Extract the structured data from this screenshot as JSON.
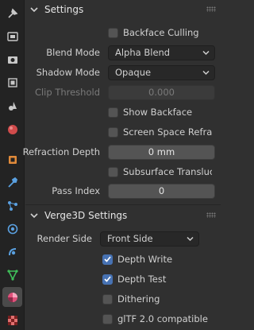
{
  "tabs": [
    {
      "icon": "tool-icon",
      "color": "#c8c8c8"
    },
    {
      "icon": "render-icon",
      "color": "#c8c8c8"
    },
    {
      "icon": "output-icon",
      "color": "#c8c8c8"
    },
    {
      "icon": "view-layer-icon",
      "color": "#c8c8c8"
    },
    {
      "icon": "scene-icon",
      "color": "#c8c8c8"
    },
    {
      "icon": "world-icon",
      "color": "#d04b4b"
    },
    {
      "icon": "object-icon",
      "color": "#e08a3a"
    },
    {
      "icon": "modifier-icon",
      "color": "#5aa0e0"
    },
    {
      "icon": "particles-icon",
      "color": "#5aa0e0"
    },
    {
      "icon": "physics-icon",
      "color": "#5aa0e0"
    },
    {
      "icon": "constraints-icon",
      "color": "#5aa0e0"
    },
    {
      "icon": "object-data-icon",
      "color": "#3fbf5a"
    },
    {
      "icon": "material-icon",
      "color": "#e0507a"
    },
    {
      "icon": "texture-icon",
      "color": "#d04b4b"
    }
  ],
  "settings": {
    "title": "Settings",
    "backface_culling": {
      "label": "Backface Culling",
      "checked": false
    },
    "blend_mode": {
      "label": "Blend Mode",
      "value": "Alpha Blend"
    },
    "shadow_mode": {
      "label": "Shadow Mode",
      "value": "Opaque"
    },
    "clip_threshold": {
      "label": "Clip Threshold",
      "value": "0.000",
      "enabled": false
    },
    "show_backface": {
      "label": "Show Backface",
      "checked": false
    },
    "screen_space_refraction": {
      "label": "Screen Space Refract...",
      "checked": false
    },
    "refraction_depth": {
      "label": "Refraction Depth",
      "value": "0 mm"
    },
    "subsurface_translucency": {
      "label": "Subsurface Transluce...",
      "checked": false
    },
    "pass_index": {
      "label": "Pass Index",
      "value": "0"
    }
  },
  "verge3d": {
    "title": "Verge3D Settings",
    "render_side": {
      "label": "Render Side",
      "value": "Front Side"
    },
    "depth_write": {
      "label": "Depth Write",
      "checked": true
    },
    "depth_test": {
      "label": "Depth Test",
      "checked": true
    },
    "dithering": {
      "label": "Dithering",
      "checked": false
    },
    "gltf_compatible": {
      "label": "glTF 2.0 compatible",
      "checked": false
    }
  },
  "colors": {
    "accent": "#4772b3",
    "panel": "#303030",
    "tabstrip": "#232323"
  }
}
